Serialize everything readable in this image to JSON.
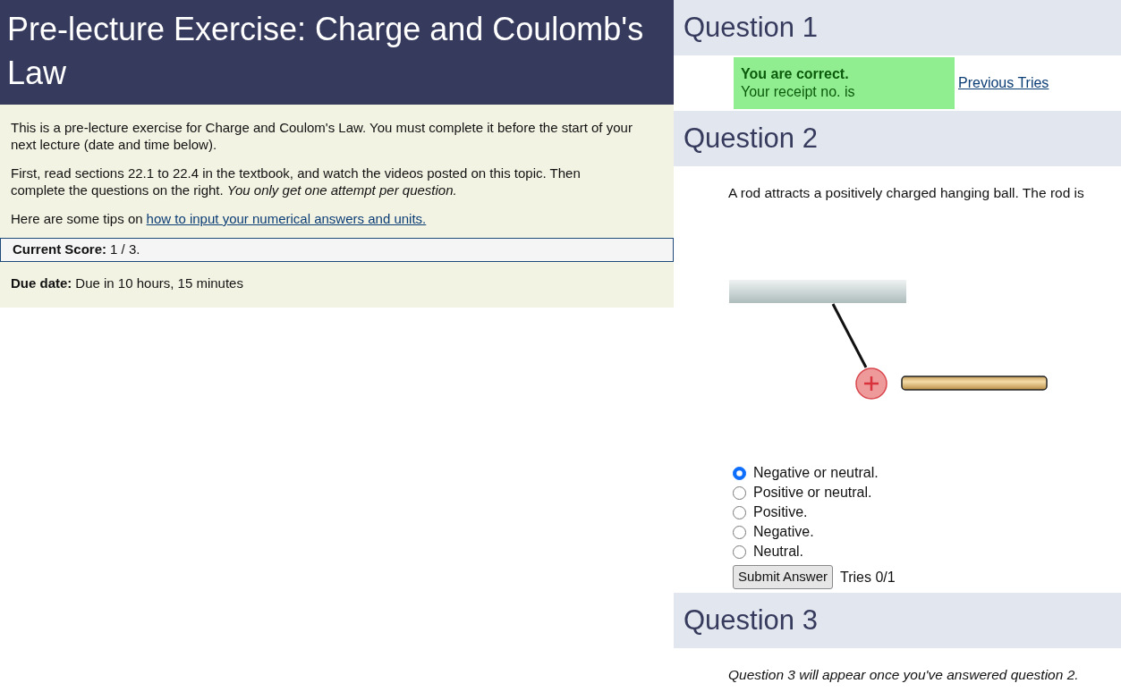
{
  "title": "Pre-lecture Exercise: Charge and Coulomb's Law",
  "intro": [
    "This is a pre-lecture exercise for Charge and Coulom's Law. You must complete it before the start of your next lecture (date and time below).",
    "First, read sections 22.1 to 22.4 in the textbook, and watch the videos posted on this topic. Then complete the questions on the right. *You only get one attempt per question.*"
  ],
  "tips": {
    "text": "Here are some tips on",
    "link": "how to input your numerical answers and units."
  },
  "score": {
    "label": "Current Score:",
    "value": "1 / 3."
  },
  "due": {
    "label": "Due date:",
    "value": "Due in 10 hours, 15 minutes"
  },
  "questions": [
    {
      "title": "Question 1",
      "kind": "answered",
      "feedback": {
        "title": "You are correct.",
        "text": "Your receipt no. is"
      },
      "link": "Previous Tries"
    },
    {
      "title": "Question 2",
      "kind": "choice",
      "prompt": "A rod attracts a positively charged hanging ball. The rod is",
      "options": [
        {
          "label": "Negative or neutral.",
          "selected": true
        },
        {
          "label": "Positive or neutral.",
          "selected": false
        },
        {
          "label": "Positive.",
          "selected": false
        },
        {
          "label": "Negative.",
          "selected": false
        },
        {
          "label": "Neutral.",
          "selected": false
        }
      ],
      "button": "Submit Answer",
      "tries": "Tries 0/1"
    },
    {
      "title": "Question 3",
      "kind": "locked",
      "note": "Question 3 will appear once you've answered question 2."
    }
  ]
}
